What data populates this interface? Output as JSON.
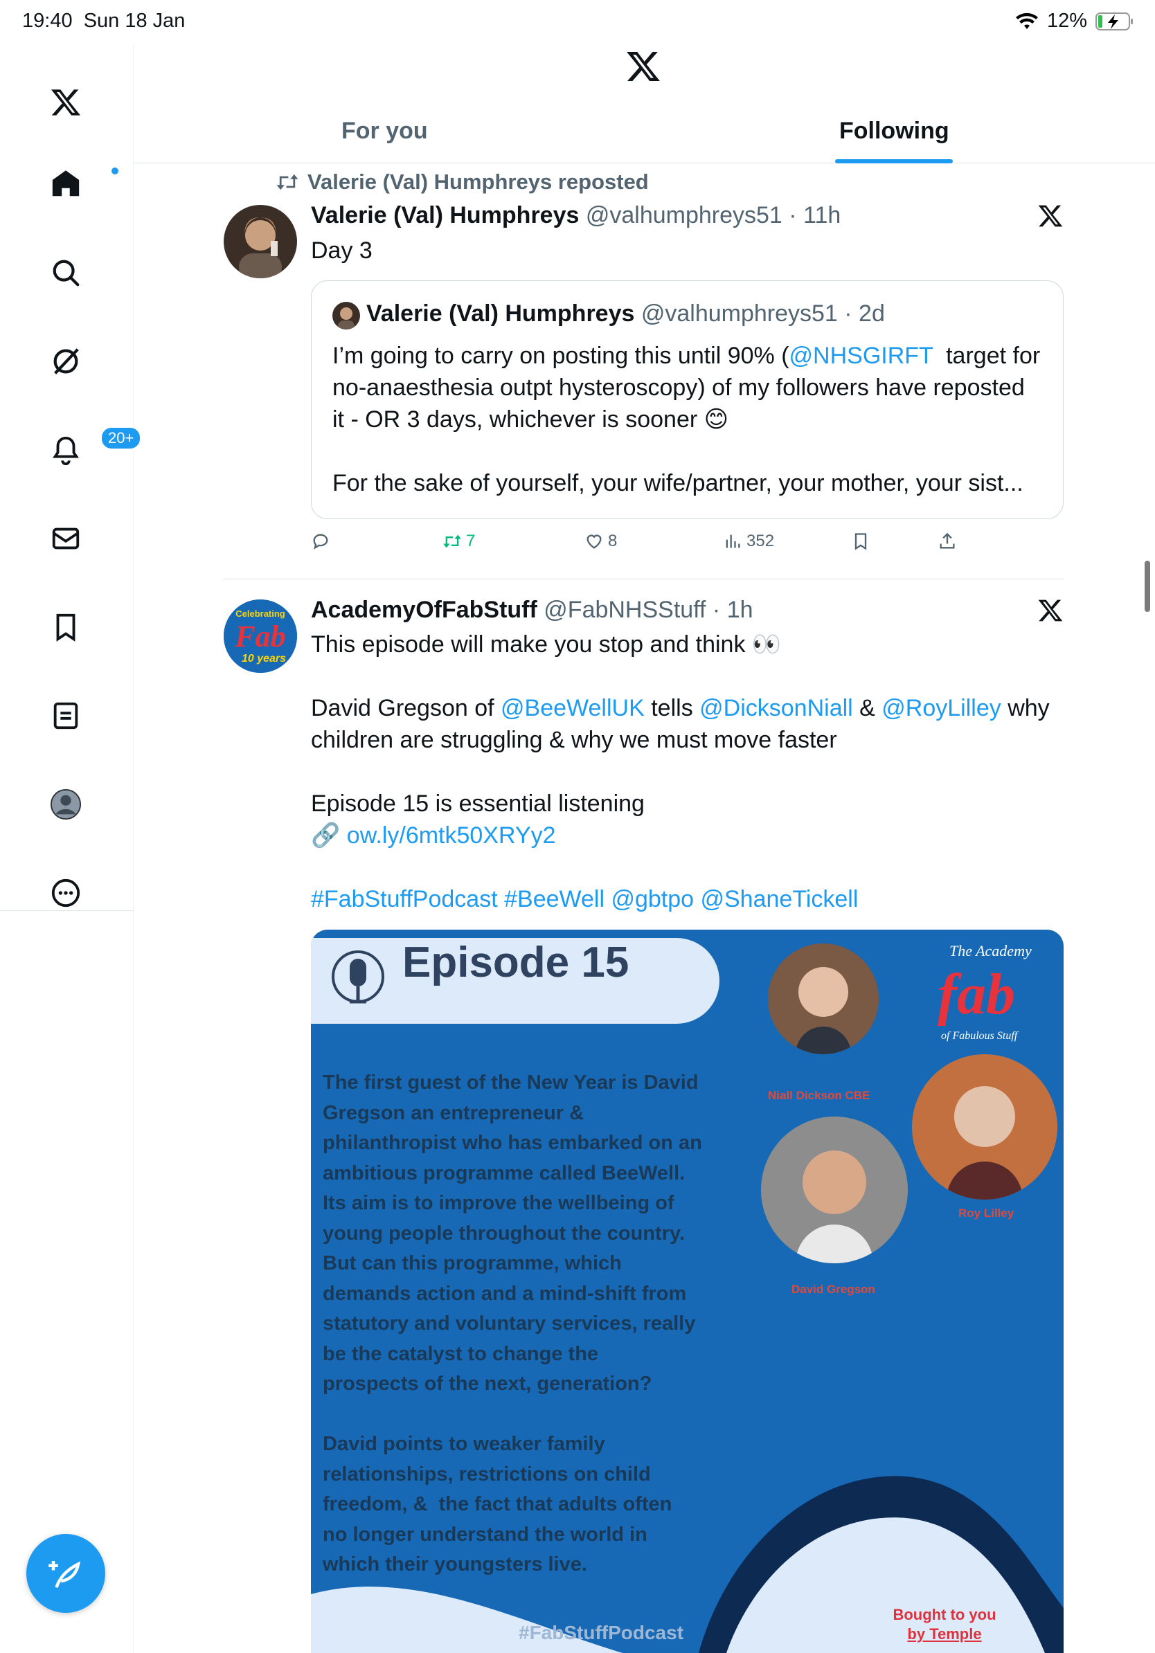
{
  "status_bar": {
    "time": "19:40",
    "date": "Sun 18 Jan",
    "battery": "12%"
  },
  "nav": {
    "notifications_badge": "20+"
  },
  "tabs": [
    {
      "label": "For you"
    },
    {
      "label": "Following"
    }
  ],
  "tweets": [
    {
      "repost_label": "Valerie (Val) Humphreys reposted",
      "name": "Valerie (Val) Humphreys",
      "meta": "@valhumphreys51 · 11h",
      "text": "Day 3",
      "quote": {
        "name": "Valerie (Val) Humphreys",
        "meta": "@valhumphreys51 · 2d",
        "line1_pre": "I’m going to carry on posting this until 90% (",
        "line1_link": "@NHSGIRFT",
        "line1_post": "  target for",
        "line2": "no-anaesthesia outpt hysteroscopy) of my followers have reposted",
        "line3": "it - OR 3 days, whichever is sooner 😊",
        "line4": "For the sake of yourself, your wife/partner, your mother, your sist..."
      },
      "reposts": "7",
      "likes": "8",
      "views": "352"
    },
    {
      "name": "AcademyOfFabStuff",
      "meta": "@FabNHSStuff · 1h",
      "line1": "This episode will make you stop and think 👀",
      "line2_a": "David Gregson of ",
      "line2_link1": "@BeeWellUK",
      "line2_b": " tells ",
      "line2_link2": "@DicksonNiall",
      "line2_c": " & ",
      "line2_link3": "@RoyLilley",
      "line2_d": " why",
      "line3": "children are struggling & why we must move faster",
      "line4": "Episode 15 is essential listening",
      "link_icon": "🔗",
      "url": "ow.ly/6mtk50XRYy2",
      "hashtags": "#FabStuffPodcast #BeeWell @gbtpo @ShaneTickell",
      "avatar_text_top": "Celebrating",
      "avatar_text_mid": "Fab",
      "avatar_text_bot": "10 years",
      "media": {
        "episode": "Episode 15",
        "body": "The first guest of the New Year is David\nGregson an entrepreneur &\nphilanthropist who has embarked on an\nambitious programme called BeeWell.\nIts aim is to improve the wellbeing of\nyoung people throughout the country.\nBut can this programme, which\ndemands action and a mind-shift from\nstatutory and voluntary services, really\nbe the catalyst to change the\nprospects of the next, generation?\n\nDavid points to weaker family\nrelationships, restrictions on child\nfreedom, &  the fact that adults often\nno longer understand the world in\nwhich their youngsters live.",
        "tag": "#FabStuffPodcast",
        "guest1": "Niall Dickson CBE",
        "guest2": "Roy Lilley",
        "guest3": "David Gregson",
        "brand_top": "The Academy",
        "brand_fab": "fab",
        "brand_sub": "of Fabulous Stuff",
        "bought_line1": "Bought to you",
        "bought_line2": "by Temple"
      }
    }
  ]
}
